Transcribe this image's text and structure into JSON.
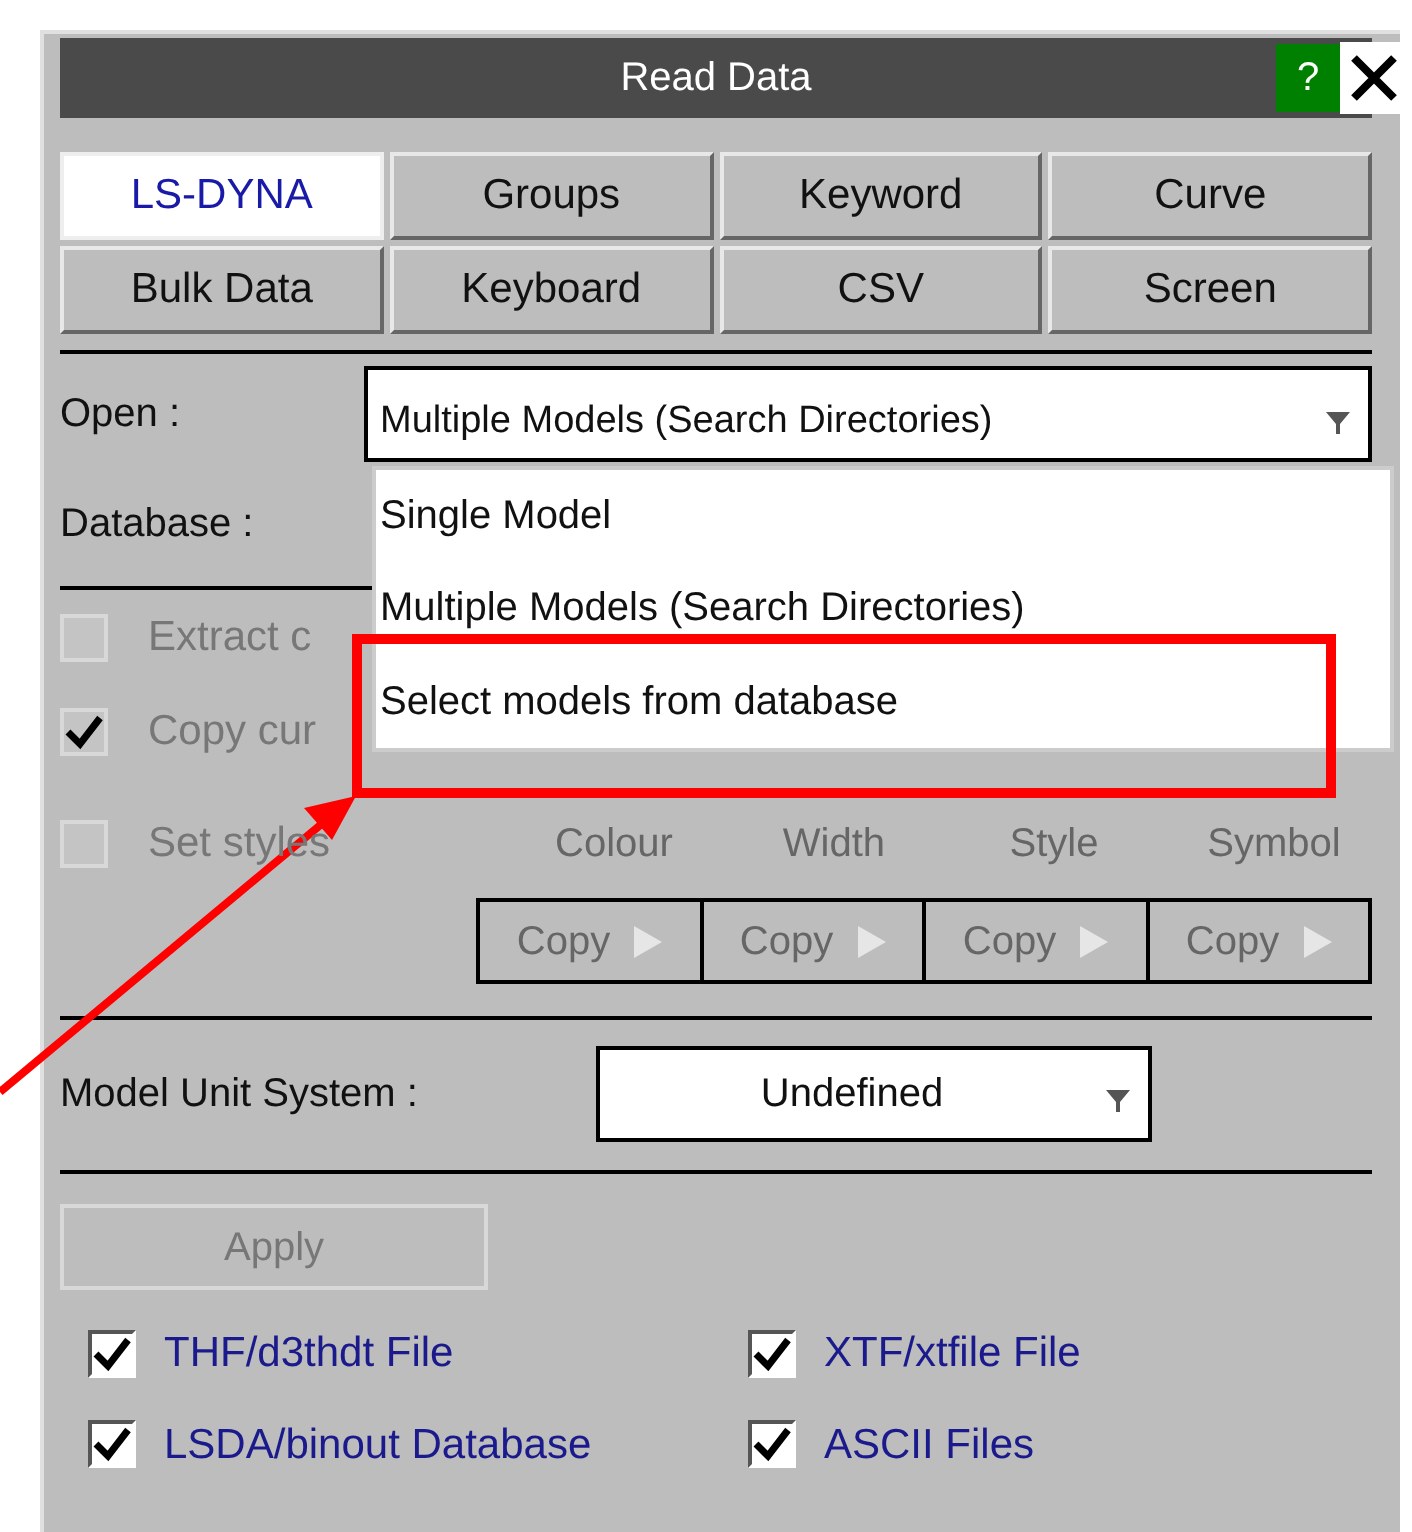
{
  "window": {
    "title": "Read Data",
    "help": "?"
  },
  "tabs": [
    {
      "label": "LS-DYNA",
      "selected": true
    },
    {
      "label": "Groups",
      "selected": false
    },
    {
      "label": "Keyword",
      "selected": false
    },
    {
      "label": "Curve",
      "selected": false
    },
    {
      "label": "Bulk Data",
      "selected": false
    },
    {
      "label": "Keyboard",
      "selected": false
    },
    {
      "label": "CSV",
      "selected": false
    },
    {
      "label": "Screen",
      "selected": false
    }
  ],
  "open": {
    "label": "Open :",
    "value": "Multiple Models (Search Directories)",
    "expanded": true,
    "options": [
      "Single Model",
      "Multiple Models (Search Directories)",
      "Select models from database"
    ]
  },
  "database": {
    "label": "Database :"
  },
  "options": [
    {
      "label": "Extract c",
      "checked": false,
      "disabled": true
    },
    {
      "label": "Copy cur",
      "checked": true,
      "disabled": true
    },
    {
      "label": "Set styles",
      "checked": false,
      "disabled": true
    }
  ],
  "style_columns": [
    "Colour",
    "Width",
    "Style",
    "Symbol"
  ],
  "copy_buttons": [
    {
      "label": "Copy",
      "disabled": true
    },
    {
      "label": "Copy",
      "disabled": true
    },
    {
      "label": "Copy",
      "disabled": true
    },
    {
      "label": "Copy",
      "disabled": true
    }
  ],
  "unit_system": {
    "label": "Model Unit System :",
    "value": "Undefined"
  },
  "apply": {
    "label": "Apply",
    "disabled": true
  },
  "file_types": [
    {
      "label": "THF/d3thdt File",
      "checked": true
    },
    {
      "label": "XTF/xtfile File",
      "checked": true
    },
    {
      "label": "LSDA/binout Database",
      "checked": true
    },
    {
      "label": "ASCII Files",
      "checked": true
    }
  ]
}
